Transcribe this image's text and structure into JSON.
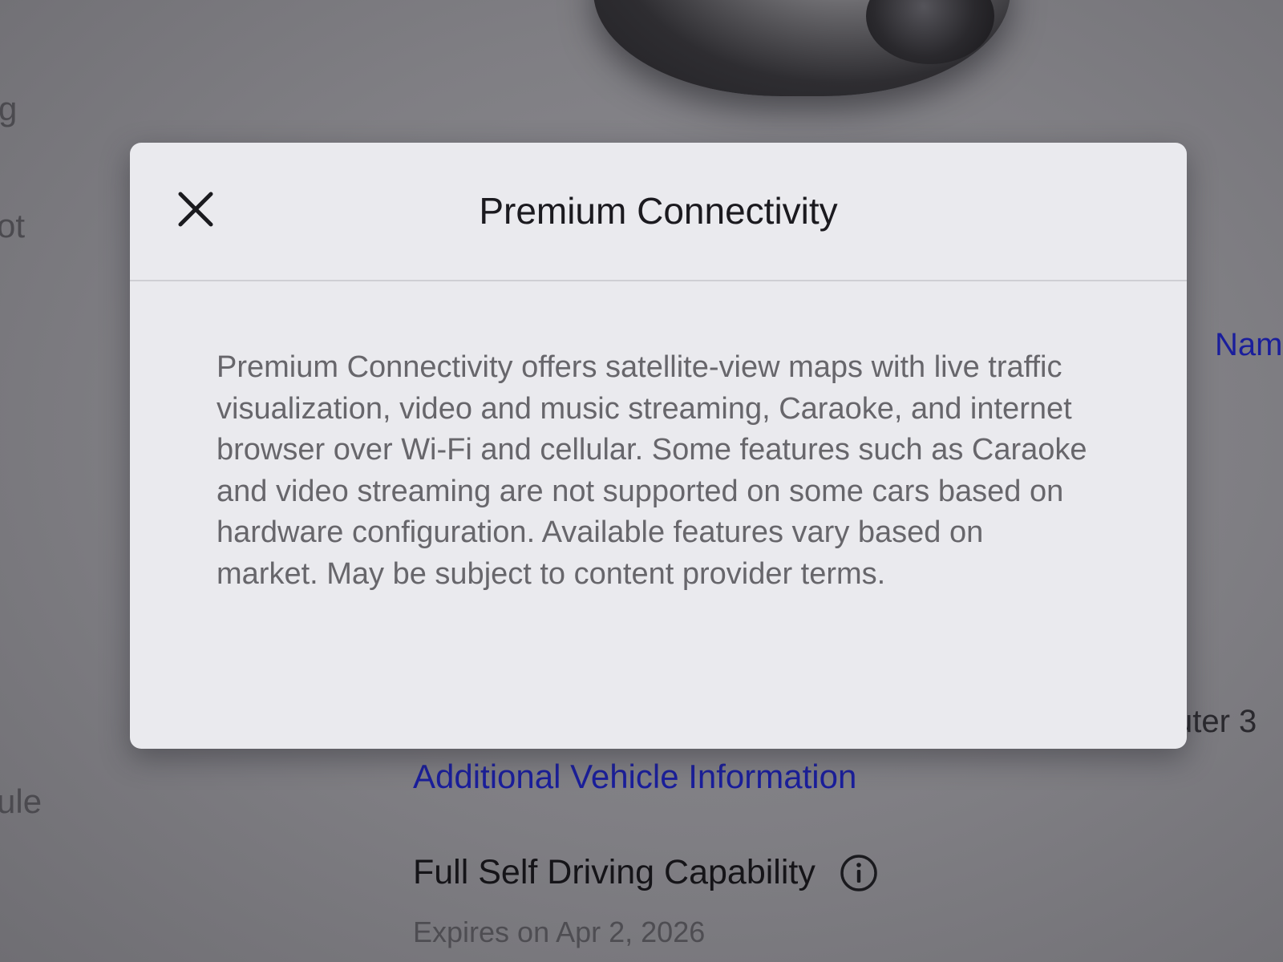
{
  "background": {
    "left_edge_fragments": [
      "g",
      "ot",
      "ule"
    ],
    "right_edge_fragments": {
      "link": "Nam",
      "text": "uter 3"
    },
    "link": "Additional Vehicle Information",
    "fsd": {
      "title": "Full Self Driving Capability",
      "subtitle": "Expires on Apr 2, 2026",
      "info_icon": "info-circle-icon"
    }
  },
  "modal": {
    "title": "Premium Connectivity",
    "close_icon": "close-icon",
    "body": "Premium Connectivity offers satellite-view maps with live traffic visualization, video and music streaming, Caraoke, and internet browser over Wi-Fi and cellular. Some features such as Caraoke and video streaming are not supported on some cars based on hardware configuration. Available features vary based on market. May be subject to content provider terms."
  },
  "colors": {
    "link": "#1a1e9c",
    "modal_background": "#eaeaee",
    "screen_background": "#7f7e83"
  }
}
